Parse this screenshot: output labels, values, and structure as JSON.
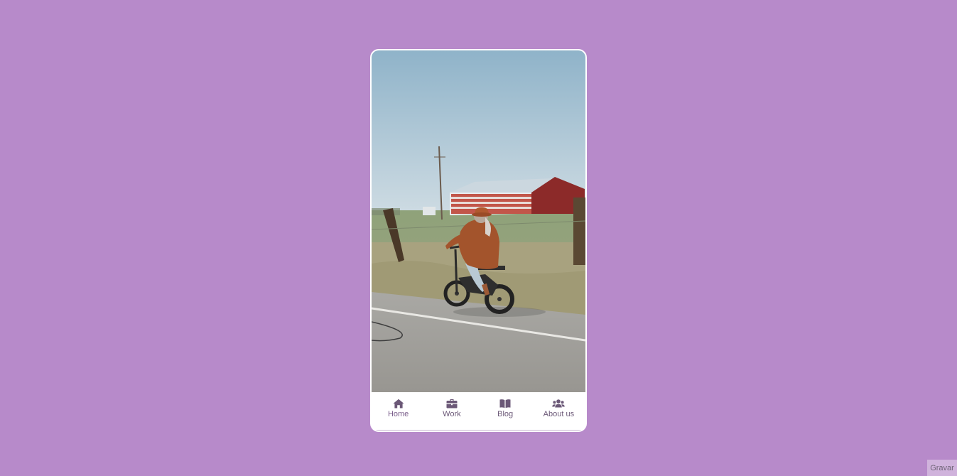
{
  "app": {
    "background_color": "#b78aca",
    "accent_color": "#6b5877"
  },
  "hero": {
    "image_description_icon": "photo-cyclist-on-road"
  },
  "navbar": {
    "items": [
      {
        "label": "Home",
        "icon": "home-icon",
        "active": true
      },
      {
        "label": "Work",
        "icon": "briefcase-icon",
        "active": false
      },
      {
        "label": "Blog",
        "icon": "book-icon",
        "active": false
      },
      {
        "label": "About us",
        "icon": "users-icon",
        "active": false
      }
    ]
  },
  "record": {
    "label": "Gravar"
  }
}
